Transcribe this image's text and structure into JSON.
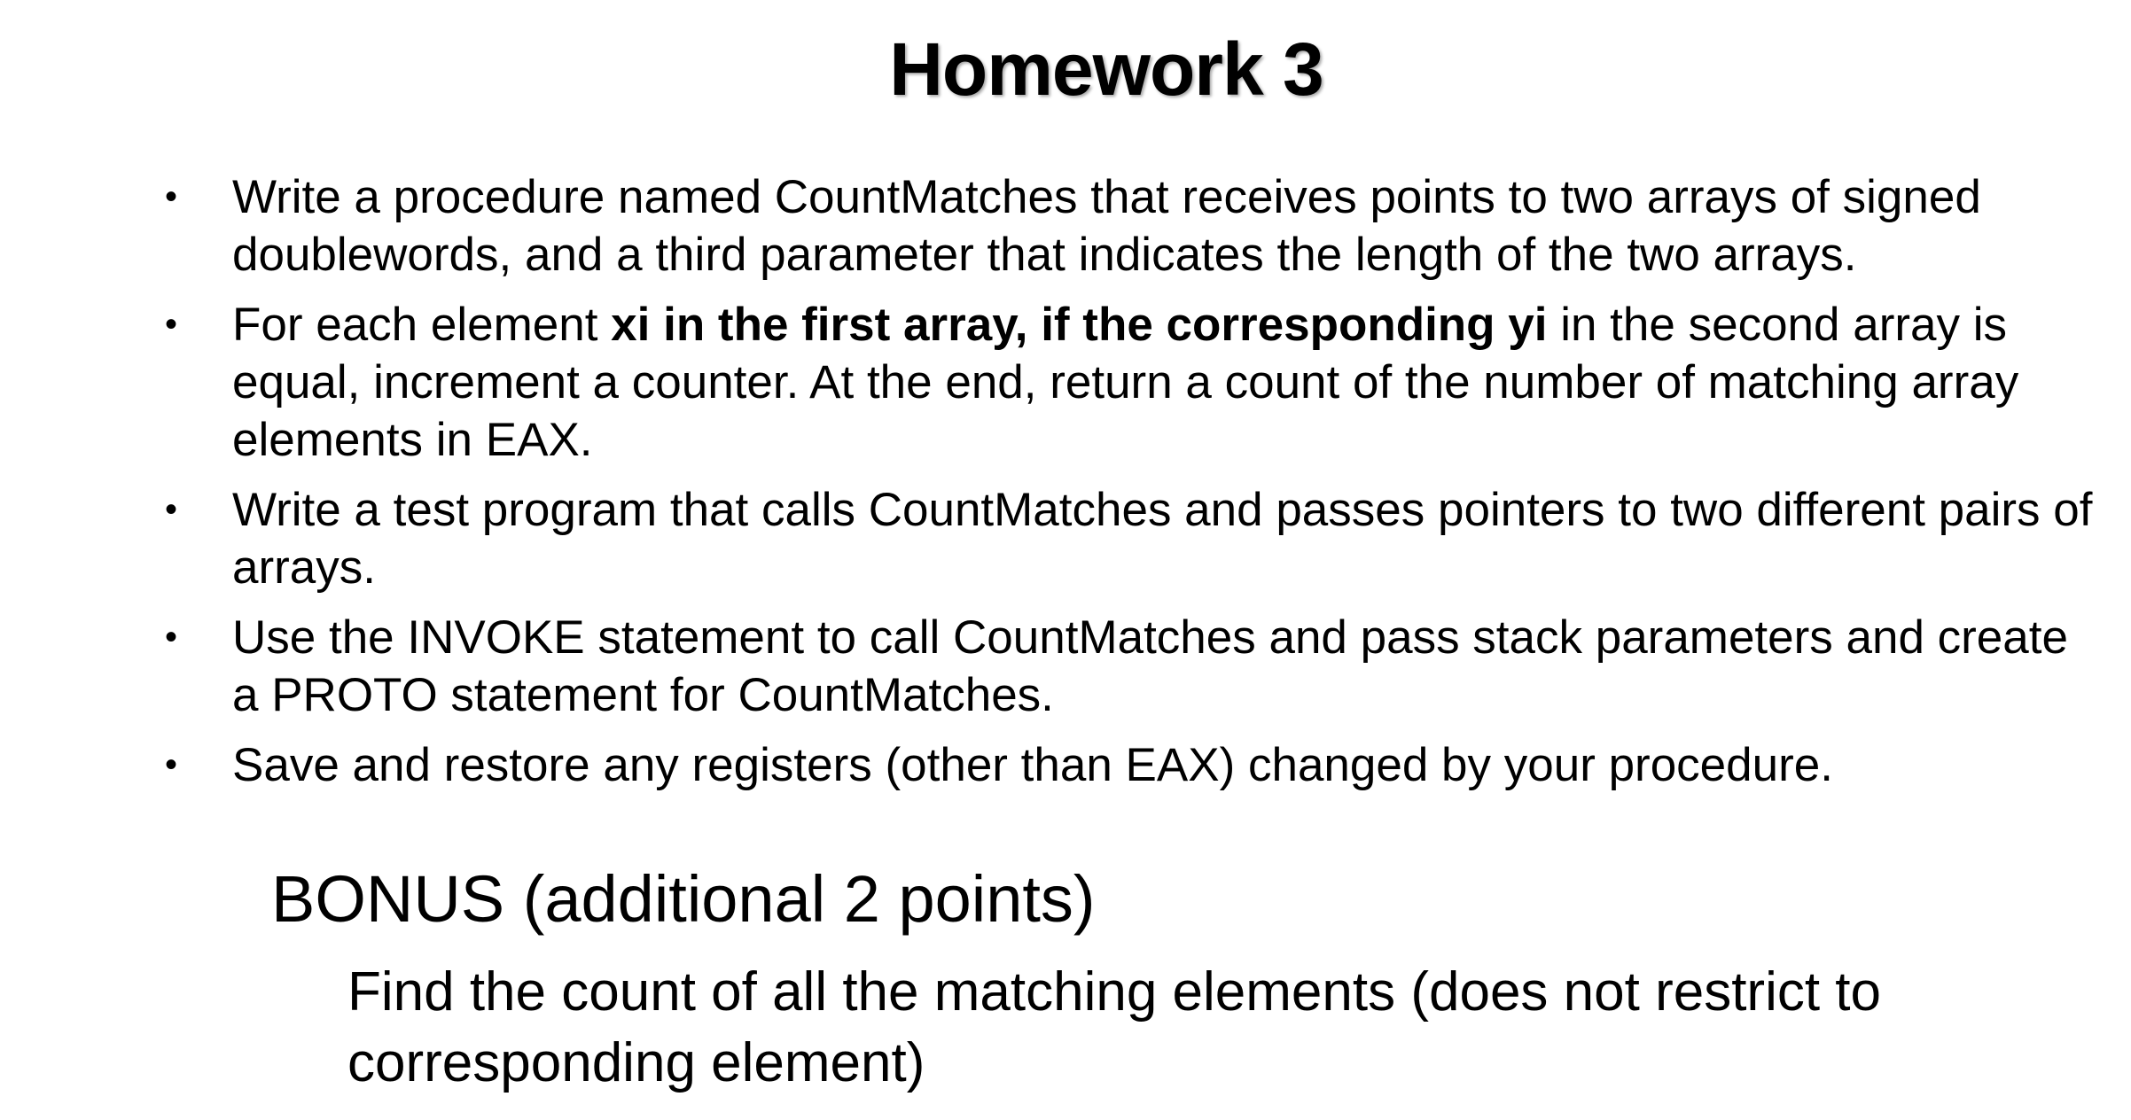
{
  "title": "Homework 3",
  "bullets": [
    {
      "text_before": "Write a procedure named CountMatches that receives points to two arrays of signed doublewords, and a third parameter that indicates the length of the two arrays.",
      "bold": "",
      "text_after": ""
    },
    {
      "text_before": "For each element ",
      "bold": "xi in the first array, if the corresponding yi",
      "text_after": " in the second array is equal, increment a counter. At the end, return a count of the number of matching array elements in EAX."
    },
    {
      "text_before": "Write a test program that calls CountMatches and passes pointers to two different pairs of arrays.",
      "bold": "",
      "text_after": ""
    },
    {
      "text_before": "Use the INVOKE statement to call CountMatches and pass stack parameters and create a PROTO statement for CountMatches.",
      "bold": "",
      "text_after": ""
    },
    {
      "text_before": "Save and restore any registers (other than EAX) changed by your procedure.",
      "bold": "",
      "text_after": ""
    }
  ],
  "bullet_glyph": "•",
  "bonus": {
    "title": "BONUS (additional 2 points)",
    "text": "Find the count of all the matching elements (does not restrict to corresponding element)"
  }
}
